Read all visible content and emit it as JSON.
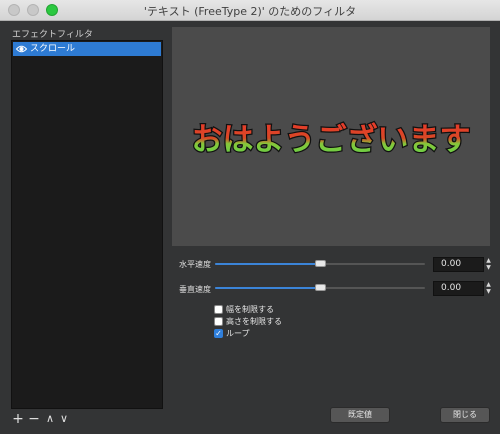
{
  "window": {
    "title": "'テキスト (FreeType 2)' のためのフィルタ"
  },
  "filters": {
    "label": "エフェクトフィルタ",
    "items": [
      {
        "name": "スクロール",
        "visible": true,
        "selected": true
      }
    ]
  },
  "list_controls": {
    "add": "+",
    "remove": "−",
    "up": "∧",
    "down": "∨"
  },
  "preview": {
    "text": "おはようございます"
  },
  "properties": {
    "horizontal_speed": {
      "label": "水平速度",
      "value": "0.00",
      "fraction": 0.5
    },
    "vertical_speed": {
      "label": "垂直速度",
      "value": "0.00",
      "fraction": 0.5
    },
    "limit_width": {
      "label": "幅を制限する",
      "checked": false
    },
    "limit_height": {
      "label": "高さを制限する",
      "checked": false
    },
    "loop": {
      "label": "ループ",
      "checked": true
    }
  },
  "buttons": {
    "defaults": "既定値",
    "close": "閉じる"
  },
  "colors": {
    "selection": "#2e7bd3",
    "accent": "#3b84d8",
    "max_button": "#2bc840"
  },
  "icons": {
    "eye": "eye-icon"
  }
}
